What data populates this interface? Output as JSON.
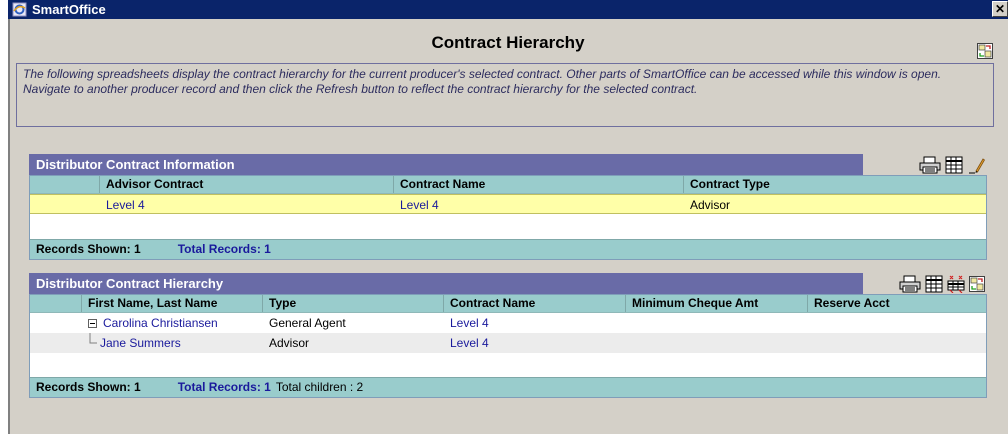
{
  "titlebar": {
    "title": "SmartOffice",
    "close_glyph": "✕"
  },
  "window": {
    "title": "Contract Hierarchy"
  },
  "description": "The following spreadsheets display the contract hierarchy for the current producer's selected contract. Other parts of SmartOffice can be accessed while this window is open. Navigate to another producer record and then click the Refresh button to reflect the contract hierarchy for the selected contract.",
  "info": {
    "header": "Distributor Contract Information",
    "columns": [
      "Advisor Contract",
      "Contract Name",
      "Contract Type"
    ],
    "rows": [
      {
        "advisor_contract": "Level 4",
        "contract_name": "Level 4",
        "contract_type": "Advisor"
      }
    ],
    "footer": {
      "shown": "Records Shown: 1",
      "total": "Total Records: 1"
    },
    "toolbar_icons": [
      "printer-icon",
      "grid-icon",
      "edit-pencil-icon"
    ]
  },
  "hierarchy": {
    "header": "Distributor Contract Hierarchy",
    "columns": [
      "First Name, Last Name",
      "Type",
      "Contract Name",
      "Minimum Cheque Amt",
      "Reserve Acct"
    ],
    "rows": [
      {
        "name": "Carolina Christiansen",
        "type": "General Agent",
        "contract_name": "Level 4",
        "min_cheque": "",
        "reserve": ""
      },
      {
        "name": "Jane Summers",
        "type": "Advisor",
        "contract_name": "Level 4",
        "min_cheque": "",
        "reserve": ""
      }
    ],
    "footer": {
      "shown": "Records Shown: 1",
      "total": "Total Records: 1",
      "children": "Total children : 2"
    },
    "toolbar_icons": [
      "printer-icon",
      "grid-icon",
      "collapse-columns-icon",
      "refresh-icon"
    ]
  },
  "colors": {
    "section_header": "#696ba7",
    "grid_header": "#99cccc",
    "selected_row": "#ffffa8",
    "link": "#1a1a9c",
    "titlebar": "#0a246a"
  }
}
